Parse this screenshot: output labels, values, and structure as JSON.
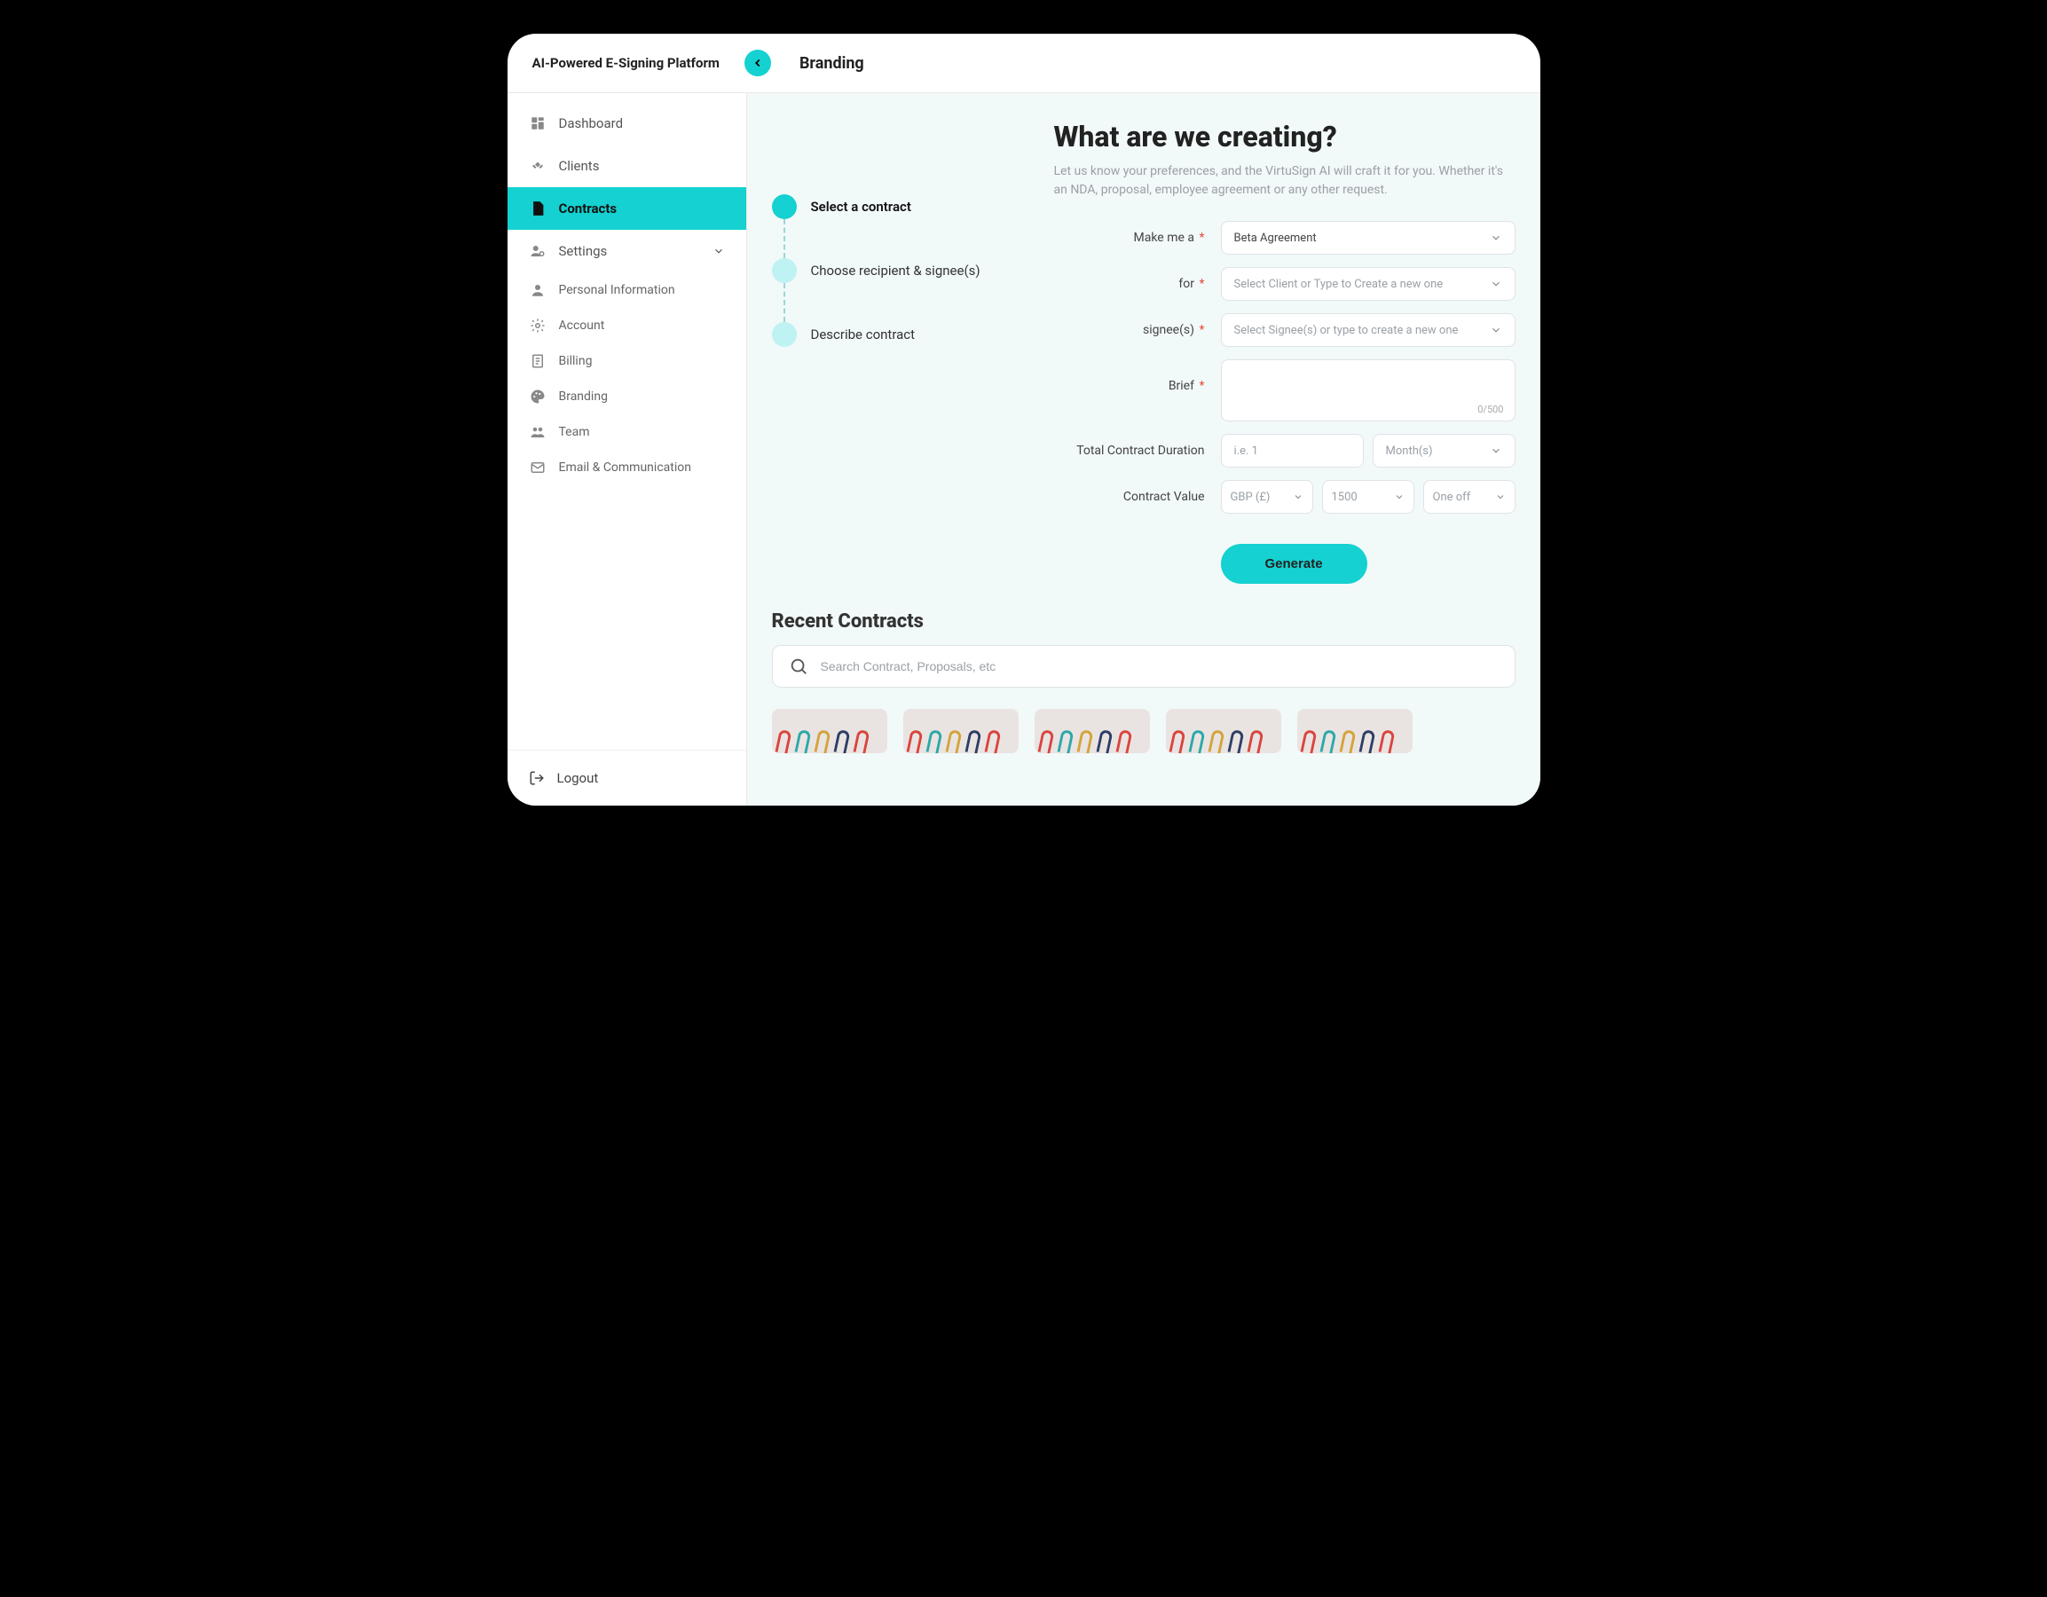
{
  "app": {
    "title": "AI-Powered E-Signing Platform",
    "page": "Branding"
  },
  "sidebar": {
    "main": [
      {
        "label": "Dashboard"
      },
      {
        "label": "Clients"
      },
      {
        "label": "Contracts"
      },
      {
        "label": "Settings"
      }
    ],
    "sub": [
      {
        "label": "Personal Information"
      },
      {
        "label": "Account"
      },
      {
        "label": "Billing"
      },
      {
        "label": "Branding"
      },
      {
        "label": "Team"
      },
      {
        "label": "Email & Communication"
      }
    ],
    "logout": "Logout"
  },
  "steps": [
    {
      "label": "Select a contract"
    },
    {
      "label": "Choose recipient & signee(s)"
    },
    {
      "label": "Describe contract"
    }
  ],
  "hero": {
    "heading": "What are we creating?",
    "subtext": "Let us know your preferences, and the VirtuSign AI will craft it for you. Whether it's an NDA, proposal, employee agreement or any other request."
  },
  "form": {
    "make_label": "Make me a",
    "make_value": "Beta Agreement",
    "for_label": "for",
    "for_placeholder": "Select Client or Type to Create a new one",
    "signee_label": "signee(s)",
    "signee_placeholder": "Select Signee(s) or type to create a new one",
    "brief_label": "Brief",
    "brief_count": "0/500",
    "duration_label": "Total Contract Duration",
    "duration_placeholder": "i.e. 1",
    "duration_unit": "Month(s)",
    "value_label": "Contract Value",
    "currency": "GBP (£)",
    "amount": "1500",
    "frequency": "One off",
    "generate": "Generate"
  },
  "recent": {
    "title": "Recent Contracts",
    "search_placeholder": "Search Contract, Proposals, etc"
  }
}
